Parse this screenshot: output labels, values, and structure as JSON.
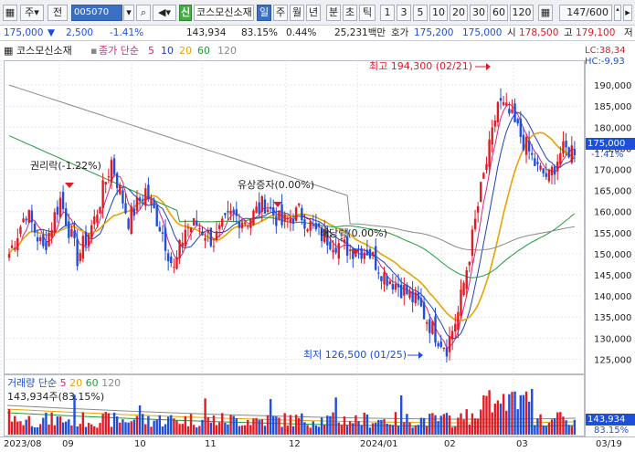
{
  "toolbar": {
    "market_select": "주",
    "type_label": "전",
    "stock_code": "005070",
    "badge_new": "신",
    "stock_name": "코스모신소재",
    "period_tabs": [
      "일",
      "주",
      "월",
      "년",
      "분",
      "초",
      "틱"
    ],
    "period_selected": "일",
    "intervals": [
      "1",
      "3",
      "5",
      "10",
      "20",
      "30",
      "60",
      "120"
    ],
    "page_count": "147/600"
  },
  "quote": {
    "price": "175,000",
    "change_symbol": "▼",
    "change": "2,500",
    "change_pct": "-1.41%",
    "volume": "143,934",
    "vol_ratio": "83.15%",
    "turnover": "0.44%",
    "amount": "25,231백만",
    "label_ask": "호가",
    "ask": "175,200",
    "bid": "175,000",
    "label_open": "시",
    "open": "178,500",
    "label_high": "고",
    "high": "179,100",
    "label_low": "저"
  },
  "chart_header": {
    "stock_name": "코스모신소재",
    "label": "종가 단순",
    "ma": [
      "5",
      "10",
      "20",
      "60",
      "120"
    ],
    "ma_colors": [
      "#e0227d",
      "#1d3fbf",
      "#e8a300",
      "#1f9a3a",
      "#8a8a8a"
    ]
  },
  "right_legend": {
    "lc": "LC:38,34",
    "hc": "HC:-9,93"
  },
  "annotations": {
    "high_label": "최고 194,300 (02/21)",
    "low_label": "최저 126,500 (01/25)",
    "rights_label": "권리락(-1.22%)",
    "capital_label": "유상증자(0.00%)",
    "dividend_label": "배당락(0.00%)"
  },
  "price_axis": [
    "190,000",
    "185,000",
    "180,000",
    "175,000",
    "170,000",
    "165,000",
    "160,000",
    "155,000",
    "150,000",
    "145,000",
    "140,000",
    "135,000",
    "130,000",
    "125,000"
  ],
  "price_tag": {
    "price": "175,000",
    "pct": "-1.41%"
  },
  "volume_panel": {
    "title": "거래량 단순",
    "ma": [
      "5",
      "20",
      "60",
      "120"
    ],
    "ma_colors": [
      "#e0227d",
      "#e8a300",
      "#1f9a3a",
      "#8a8a8a"
    ],
    "current": "143,934주(83.15%)",
    "tag_value": "143,934",
    "tag_pct": "83.15%"
  },
  "x_axis": [
    "2023/08",
    "09",
    "10",
    "11",
    "12",
    "2024/01",
    "02",
    "03",
    "03/19"
  ],
  "colors": {
    "up": "#e01b24",
    "down": "#1d4fd8",
    "accent": "#3a6fc4"
  },
  "chart_data": {
    "type": "candlestick",
    "price_range": [
      122500,
      195000
    ],
    "periods": [
      "2023/08",
      "09",
      "10",
      "11",
      "12",
      "2024/01",
      "02",
      "03"
    ],
    "high": {
      "value": 194300,
      "date": "02/21"
    },
    "low": {
      "value": 126500,
      "date": "01/25"
    },
    "last_close": 175000,
    "moving_averages": [
      5,
      10,
      20,
      60,
      120
    ],
    "ma_approx": {
      "ma20_end": 173000,
      "ma60_end": 156000,
      "ma120_start": 190000
    }
  }
}
